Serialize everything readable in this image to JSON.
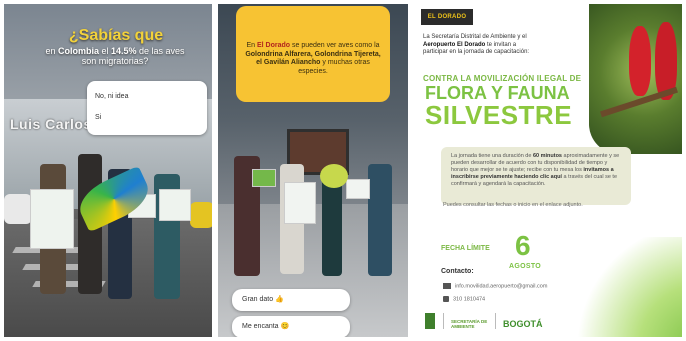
{
  "panel1": {
    "headline": "¿Sabías que",
    "sub_prefix": "en ",
    "sub_country": "Colombia",
    "sub_mid": " el ",
    "sub_percent": "14.5%",
    "sub_suffix": " de las aves",
    "sub_line2": "son migratorias?",
    "building_sign": "Luis Carlos G",
    "poll": {
      "option1": "No, ni idea",
      "option2": "Si"
    }
  },
  "panel2": {
    "banner": {
      "lead": "En ",
      "place": "El Dorado",
      "lead2": " se pueden ver aves como la ",
      "species": "Golondrina Alfarera, Golondrina Tijereta, el Gavilán Aliancho",
      "tail": " y muchas otras especies."
    },
    "replies": [
      {
        "text": "Gran dato ",
        "emoji": "👍"
      },
      {
        "text": "Me encanta ",
        "emoji": "😊"
      }
    ]
  },
  "panel3": {
    "logo": "EL DORADO",
    "intro_1": "La Secretaría Distrital de Ambiente",
    "intro_2": " y el ",
    "intro_3": "Aeropuerto El Dorado",
    "intro_4": " te invitan a participar en la jornada de capacitación:",
    "kicker": "CONTRA LA MOVILIZACIÓN ILEGAL DE",
    "title_line1": "FLORA Y FAUNA",
    "title_line2": "SILVESTRE",
    "box_text": "La jornada tiene una duración de ",
    "box_duration": "60 minutos",
    "box_text2": " aproximadamente y se pueden desarrollar de acuerdo con tu disponibilidad de tiempo y horario que mejor se te ajuste; recibe con tu mesa los ",
    "box_links": "invitamos a inscribirse previamente haciendo clic aquí",
    "box_text3": " a través del cual se te confirmará y agendará la capacitación.",
    "note": "Puedes consultar las fechas o inicio en el enlace adjunto.",
    "fecha_label": "FECHA LÍMITE",
    "day": "6",
    "month": "AGOSTO",
    "contact_label": "Contacto:",
    "contact_email": "info.movilidad.aeropuerto@gmail.com",
    "contact_phone": "310 1810474",
    "footer_logos": [
      "SECRETARÍA DE AMBIENTE",
      "BOGOTÁ"
    ]
  }
}
